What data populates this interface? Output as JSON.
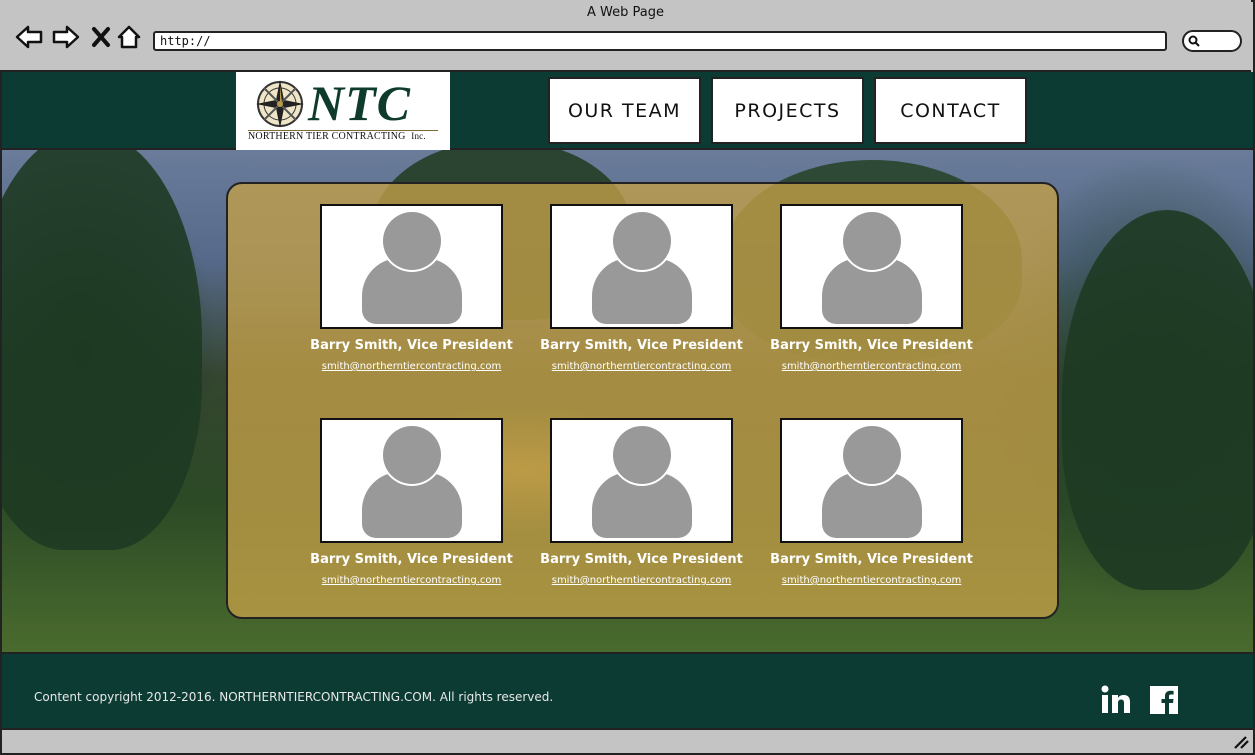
{
  "window": {
    "title": "A Web Page"
  },
  "browser": {
    "url": "http://"
  },
  "site": {
    "logo": {
      "mark": "NTC",
      "company": "NORTHERN TIER CONTRACTING",
      "suffix": "Inc."
    },
    "nav": [
      "OUR TEAM",
      "PROJECTS",
      "CONTACT"
    ],
    "team": [
      {
        "name": "Barry Smith, Vice President",
        "email": "smith@northerntiercontracting.com"
      },
      {
        "name": "Barry Smith, Vice President",
        "email": "smith@northerntiercontracting.com"
      },
      {
        "name": "Barry Smith, Vice President",
        "email": "smith@northerntiercontracting.com"
      },
      {
        "name": "Barry Smith, Vice President",
        "email": "smith@northerntiercontracting.com"
      },
      {
        "name": "Barry Smith, Vice President",
        "email": "smith@northerntiercontracting.com"
      },
      {
        "name": "Barry Smith, Vice President",
        "email": "smith@northerntiercontracting.com"
      }
    ],
    "footer": {
      "copyright": "Content copyright 2012-2016. NORTHERNTIERCONTRACTING.COM. All rights reserved.",
      "social": [
        "linkedin-icon",
        "facebook-icon"
      ]
    }
  },
  "colors": {
    "brand": "#0c3b34",
    "panel": "#c4a048",
    "avatar": "#999999"
  }
}
